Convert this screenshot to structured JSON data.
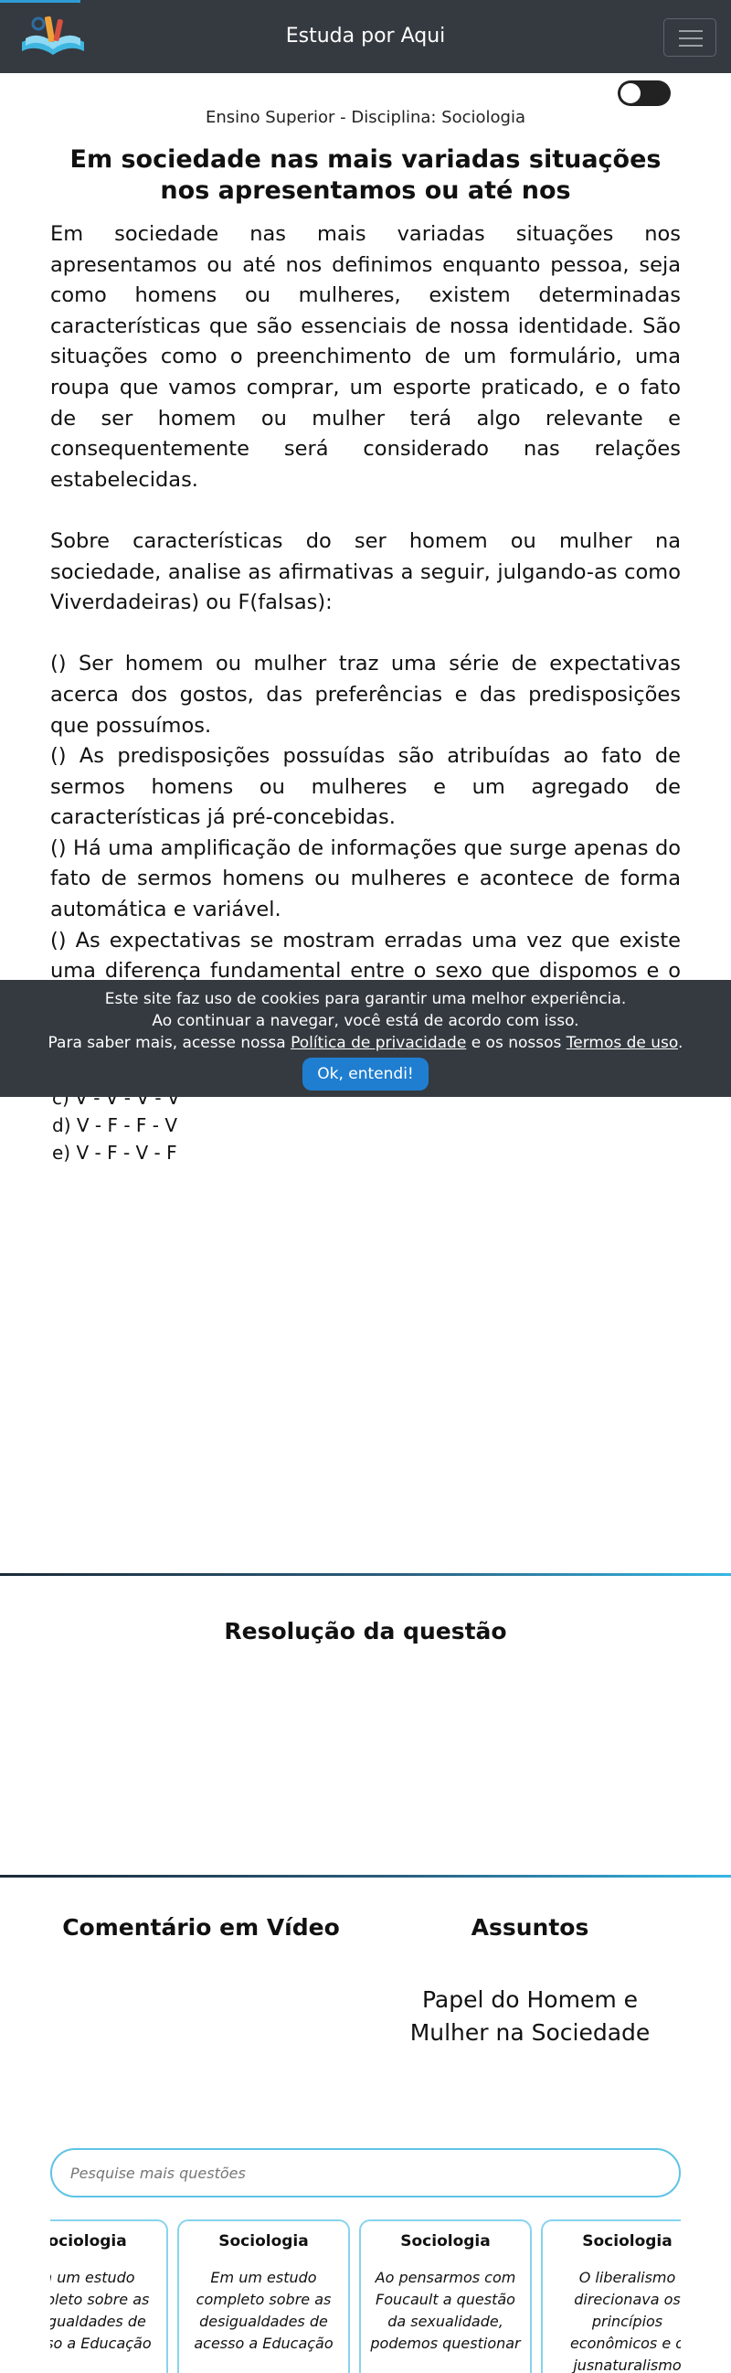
{
  "header": {
    "title": "Estuda por Aqui",
    "logo_icon": "book-logo-icon",
    "menu_icon": "hamburger-icon"
  },
  "theme_toggle": {
    "state": "off"
  },
  "breadcrumb": "Ensino Superior - Disciplina: Sociologia",
  "question": {
    "title": "Em sociedade nas mais variadas situações nos apresentamos ou até nos",
    "intro": "Em sociedade nas mais variadas situações nos apresentamos ou até nos definimos enquanto pessoa, seja como homens ou mulheres, existem determinadas características que são essenciais de nossa identidade. São situações como o preenchimento de um formulário, uma roupa que vamos comprar, um esporte praticado, e o fato de ser homem ou mulher terá algo relevante e consequentemente será considerado nas relações estabelecidas.",
    "prompt": "Sobre características do ser homem ou mulher na sociedade, analise as afirmativas a seguir, julgando-as como Viverdadeiras) ou F(falsas):",
    "statements": [
      "() Ser homem ou mulher traz uma série de expectativas acerca dos gostos, das preferências e das predisposições que possuímos.",
      "() As predisposições possuídas são atribuídas ao fato de sermos homens ou mulheres e um agregado de características já pré-concebidas.",
      "() Há uma amplificação de informações que surge apenas do fato de sermos homens ou mulheres e acontece de forma automática e variável.",
      "() As expectativas se mostram erradas uma vez que existe uma diferença fundamental entre o sexo que dispomos e o conceito de gênero vigente em uma sociedade."
    ],
    "options": [
      "c) V - V - V - V",
      "d) V - F - F - V",
      "e) V - F - V - F"
    ]
  },
  "cookie_banner": {
    "line1": "Este site faz uso de cookies para garantir uma melhor experiência.",
    "line2": "Ao continuar a navegar, você está de acordo com isso.",
    "line3_prefix": "Para saber mais, acesse nossa",
    "privacy_link": "Política de privacidade",
    "line3_mid": "e os nossos",
    "terms_link": "Termos de uso",
    "line3_suffix": ".",
    "button": "Ok, entendi!"
  },
  "resolution": {
    "title": "Resolução da questão"
  },
  "video": {
    "title": "Comentário em Vídeo"
  },
  "subjects": {
    "title": "Assuntos",
    "items": [
      "Papel do Homem e Mulher na Sociedade"
    ]
  },
  "search": {
    "placeholder": "Pesquise mais questões"
  },
  "related_cards": [
    {
      "subject": "Sociologia",
      "snippet": "Em um estudo completo sobre as desigualdades de acesso a Educação"
    },
    {
      "subject": "Sociologia",
      "snippet": "Ao pensarmos com Foucault a questão da sexualidade, podemos questionar"
    },
    {
      "subject": "Sociologia",
      "snippet": "O liberalismo direcionava os princípios econômicos e o jusnaturalismo"
    }
  ]
}
